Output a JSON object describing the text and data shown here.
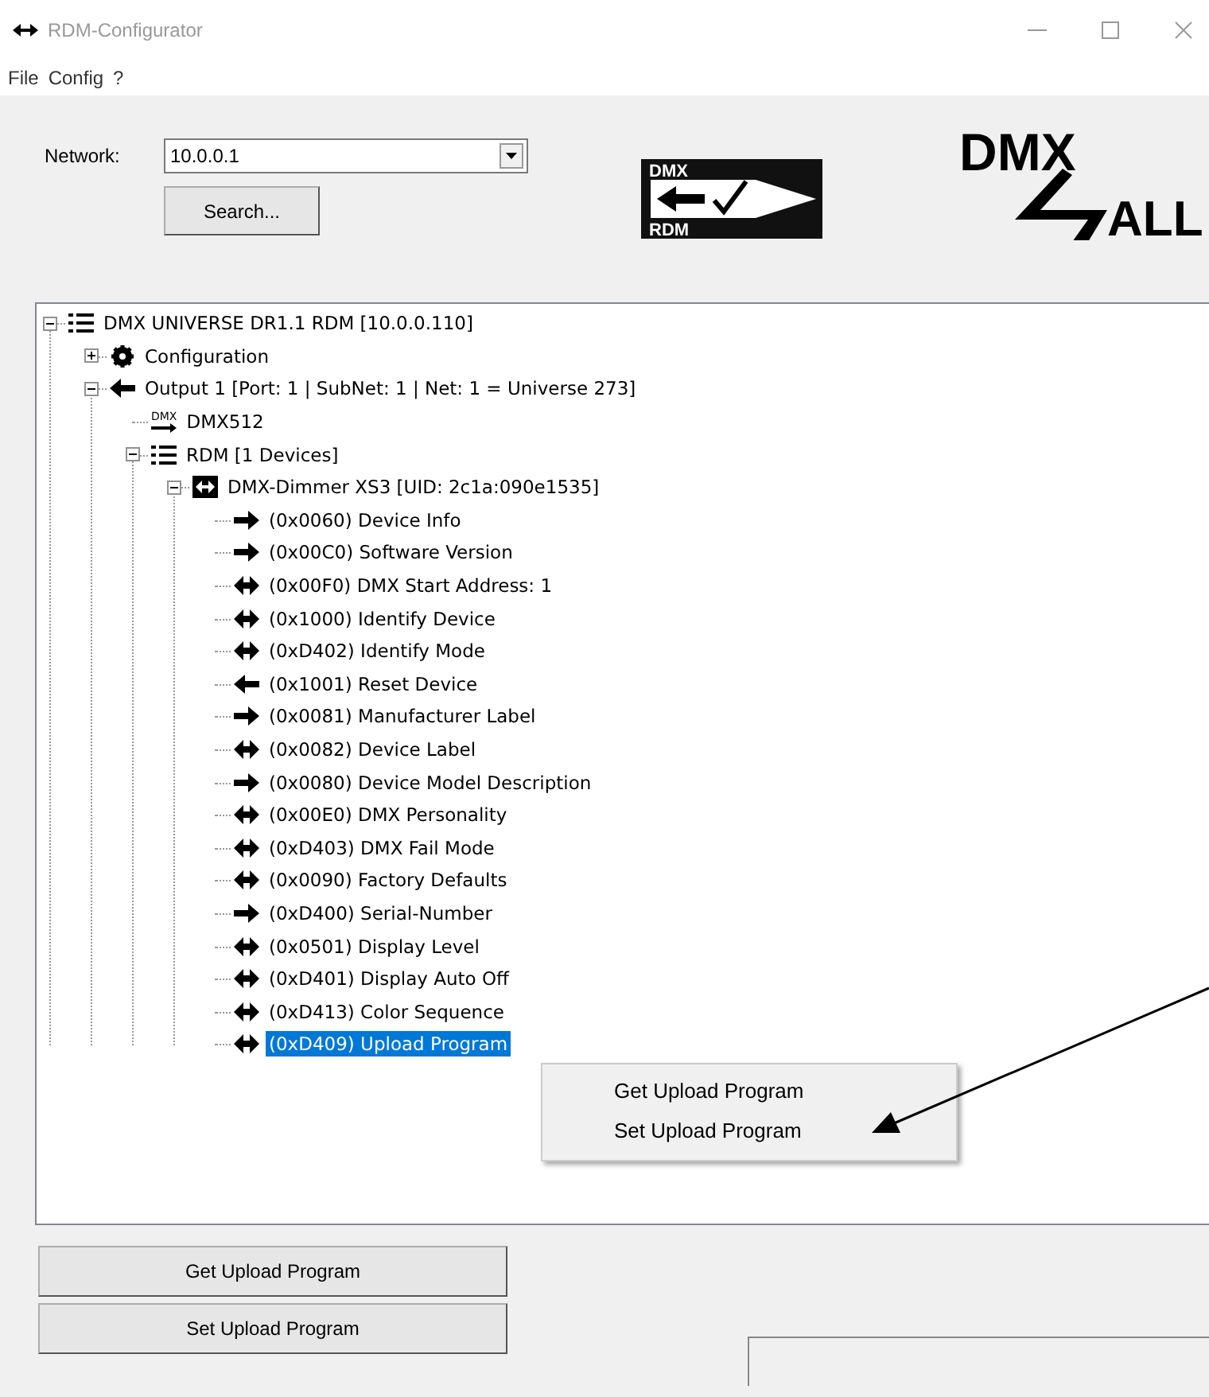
{
  "window": {
    "title": "RDM-Configurator"
  },
  "menu": [
    "File",
    "Config",
    "?"
  ],
  "network": {
    "label": "Network:",
    "value": "10.0.0.1"
  },
  "search_button": "Search...",
  "logos": {
    "dmx_rdm": [
      "DMX",
      "RDM"
    ],
    "brand": [
      "DMX",
      "ALL"
    ]
  },
  "tree": [
    {
      "label": "DMX UNIVERSE DR1.1 RDM [10.0.0.110]",
      "kind": "list",
      "expanded": true,
      "selected": false,
      "children": [
        {
          "label": "Configuration",
          "kind": "gear",
          "expanded": false,
          "selected": false
        },
        {
          "label": "Output 1 [Port: 1 | SubNet: 1 | Net: 1 = Universe 273]",
          "kind": "left",
          "expanded": true,
          "selected": false,
          "children": [
            {
              "label": "DMX512",
              "kind": "dmx",
              "icon_label": "DMX",
              "selected": false
            },
            {
              "label": "RDM [1 Devices]",
              "kind": "list",
              "expanded": true,
              "selected": false,
              "children": [
                {
                  "label": "DMX-Dimmer XS3 [UID: 2c1a:090e1535]",
                  "kind": "device",
                  "expanded": true,
                  "selected": false,
                  "children": [
                    {
                      "label": "(0x0060) Device Info",
                      "kind": "right",
                      "selected": false
                    },
                    {
                      "label": "(0x00C0) Software Version",
                      "kind": "right",
                      "selected": false
                    },
                    {
                      "label": "(0x00F0) DMX Start Address: 1",
                      "kind": "both",
                      "selected": false
                    },
                    {
                      "label": "(0x1000) Identify Device",
                      "kind": "both",
                      "selected": false
                    },
                    {
                      "label": "(0xD402) Identify Mode",
                      "kind": "both",
                      "selected": false
                    },
                    {
                      "label": "(0x1001) Reset Device",
                      "kind": "left",
                      "selected": false
                    },
                    {
                      "label": "(0x0081) Manufacturer Label",
                      "kind": "right",
                      "selected": false
                    },
                    {
                      "label": "(0x0082) Device Label",
                      "kind": "both",
                      "selected": false
                    },
                    {
                      "label": "(0x0080) Device Model Description",
                      "kind": "right",
                      "selected": false
                    },
                    {
                      "label": "(0x00E0) DMX Personality",
                      "kind": "both",
                      "selected": false
                    },
                    {
                      "label": "(0xD403) DMX Fail Mode",
                      "kind": "both",
                      "selected": false
                    },
                    {
                      "label": "(0x0090) Factory Defaults",
                      "kind": "both",
                      "selected": false
                    },
                    {
                      "label": "(0xD400) Serial-Number",
                      "kind": "right",
                      "selected": false
                    },
                    {
                      "label": "(0x0501) Display Level",
                      "kind": "both",
                      "selected": false
                    },
                    {
                      "label": "(0xD401) Display Auto Off",
                      "kind": "both",
                      "selected": false
                    },
                    {
                      "label": "(0xD413) Color Sequence",
                      "kind": "both",
                      "selected": false
                    },
                    {
                      "label": "(0xD409) Upload Program",
                      "kind": "both",
                      "selected": true
                    }
                  ]
                }
              ]
            }
          ]
        }
      ]
    }
  ],
  "context_menu": [
    {
      "label": "Get Upload Program"
    },
    {
      "label": "Set Upload Program"
    }
  ],
  "buttons": [
    "Get Upload Program",
    "Set Upload Program"
  ]
}
